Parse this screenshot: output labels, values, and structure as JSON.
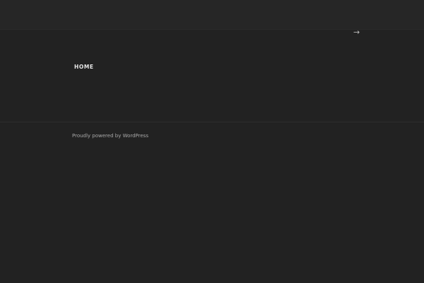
{
  "header": {
    "next_icon": "arrow-right-icon",
    "arrow_glyph": "→"
  },
  "nav": {
    "items": [
      {
        "label": "HOME"
      }
    ]
  },
  "footer": {
    "credit": "Proudly powered by WordPress"
  }
}
